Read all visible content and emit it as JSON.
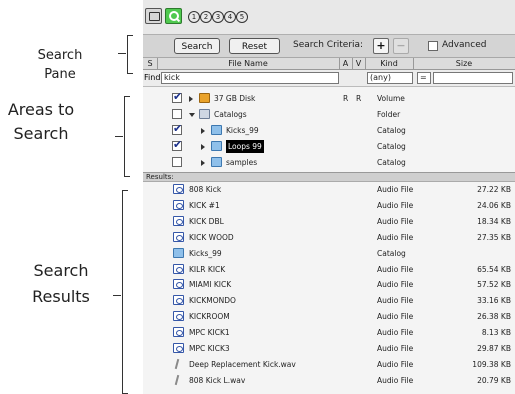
{
  "callouts": {
    "search_pane": [
      "Search",
      "Pane"
    ],
    "areas": [
      "Areas to",
      "Search"
    ],
    "results": [
      "Search",
      "Results"
    ]
  },
  "toolbar": {
    "icons": [
      "camera-icon",
      "magnifier-icon"
    ],
    "circled": [
      "1",
      "2",
      "3",
      "4",
      "5"
    ]
  },
  "search_bar": {
    "search_label": "Search",
    "reset_label": "Reset",
    "criteria_label": "Search Criteria:",
    "add_label": "+",
    "remove_label": "−",
    "advanced_label": "Advanced",
    "advanced_checked": false
  },
  "columns": [
    "S",
    "File Name",
    "A",
    "V",
    "Kind",
    "Size"
  ],
  "find_row": {
    "label": "Find",
    "name_value": "kick",
    "kind_value": "(any)",
    "size_op": "="
  },
  "areas": [
    {
      "checked": true,
      "arrow": "right",
      "icon": "disk",
      "name": "37 GB Disk",
      "a": "R",
      "v": "R",
      "kind": "Volume"
    },
    {
      "checked": false,
      "arrow": "down",
      "icon": "cat",
      "name": "Catalogs",
      "a": "",
      "v": "",
      "kind": "Folder"
    },
    {
      "checked": true,
      "arrow": "right",
      "icon": "folder",
      "name": "Kicks_99",
      "a": "",
      "v": "",
      "kind": "Catalog"
    },
    {
      "checked": true,
      "arrow": "right",
      "icon": "folder",
      "name": "Loops 99",
      "a": "",
      "v": "",
      "kind": "Catalog"
    },
    {
      "checked": false,
      "arrow": "right",
      "icon": "folder",
      "name": "samples",
      "a": "",
      "v": "",
      "kind": "Catalog"
    }
  ],
  "results_label": "Results:",
  "results": [
    {
      "icon": "audio",
      "name": "808 Kick",
      "kind": "Audio File",
      "size": "27.22 KB"
    },
    {
      "icon": "audio",
      "name": "KICK #1",
      "kind": "Audio File",
      "size": "24.06 KB"
    },
    {
      "icon": "audio",
      "name": "KICK DBL",
      "kind": "Audio File",
      "size": "18.34 KB"
    },
    {
      "icon": "audio",
      "name": "KICK WOOD",
      "kind": "Audio File",
      "size": "27.35 KB"
    },
    {
      "icon": "folder",
      "name": "Kicks_99",
      "kind": "Catalog",
      "size": ""
    },
    {
      "icon": "audio",
      "name": "KILR KICK",
      "kind": "Audio File",
      "size": "65.54 KB"
    },
    {
      "icon": "audio",
      "name": "MIAMI KICK",
      "kind": "Audio File",
      "size": "57.52 KB"
    },
    {
      "icon": "audio",
      "name": "KICKMONDO",
      "kind": "Audio File",
      "size": "33.16 KB"
    },
    {
      "icon": "audio",
      "name": "KICKROOM",
      "kind": "Audio File",
      "size": "26.38 KB"
    },
    {
      "icon": "audio",
      "name": "MPC KICK1",
      "kind": "Audio File",
      "size": "8.13 KB"
    },
    {
      "icon": "audio",
      "name": "MPC KICK3",
      "kind": "Audio File",
      "size": "29.87 KB"
    },
    {
      "icon": "wav",
      "name": "Deep Replacement Kick.wav",
      "kind": "Audio File",
      "size": "109.38 KB"
    },
    {
      "icon": "wav",
      "name": "808 Kick L.wav",
      "kind": "Audio File",
      "size": "20.79 KB"
    }
  ]
}
